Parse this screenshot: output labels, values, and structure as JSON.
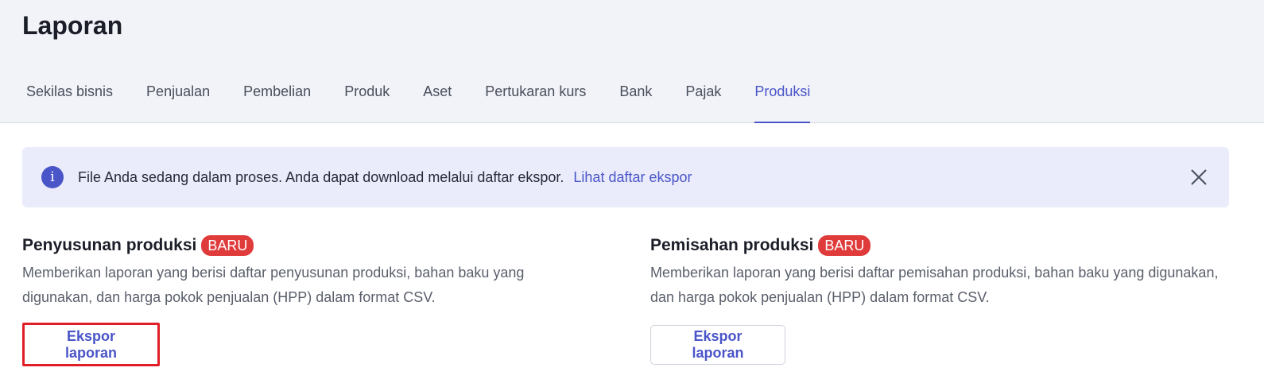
{
  "header": {
    "title": "Laporan",
    "tabs": [
      {
        "label": "Sekilas bisnis"
      },
      {
        "label": "Penjualan"
      },
      {
        "label": "Pembelian"
      },
      {
        "label": "Produk"
      },
      {
        "label": "Aset"
      },
      {
        "label": "Pertukaran kurs"
      },
      {
        "label": "Bank"
      },
      {
        "label": "Pajak"
      },
      {
        "label": "Produksi"
      }
    ],
    "active_tab": "Produksi"
  },
  "banner": {
    "icon": "info-icon",
    "icon_glyph": "i",
    "message": "File Anda sedang dalam proses. Anda dapat download melalui daftar ekspor.",
    "link": "Lihat daftar ekspor",
    "close_icon": "close-icon"
  },
  "cards": [
    {
      "title": "Penyusunan produksi",
      "badge": "BARU",
      "description": "Memberikan laporan yang berisi daftar penyusunan produksi, bahan baku yang digunakan, dan harga pokok penjualan (HPP) dalam format CSV.",
      "button": "Ekspor laporan"
    },
    {
      "title": "Pemisahan produksi",
      "badge": "BARU",
      "description": "Memberikan laporan yang berisi daftar pemisahan produksi, bahan baku yang digunakan, dan harga pokok penjualan (HPP) dalam format CSV.",
      "button": "Ekspor laporan"
    }
  ],
  "colors": {
    "accent": "#4a55c8",
    "badge": "#e03b3b",
    "banner_bg": "#eaecfb",
    "header_bg": "#f1f3f8",
    "highlight": "#e01e26"
  }
}
